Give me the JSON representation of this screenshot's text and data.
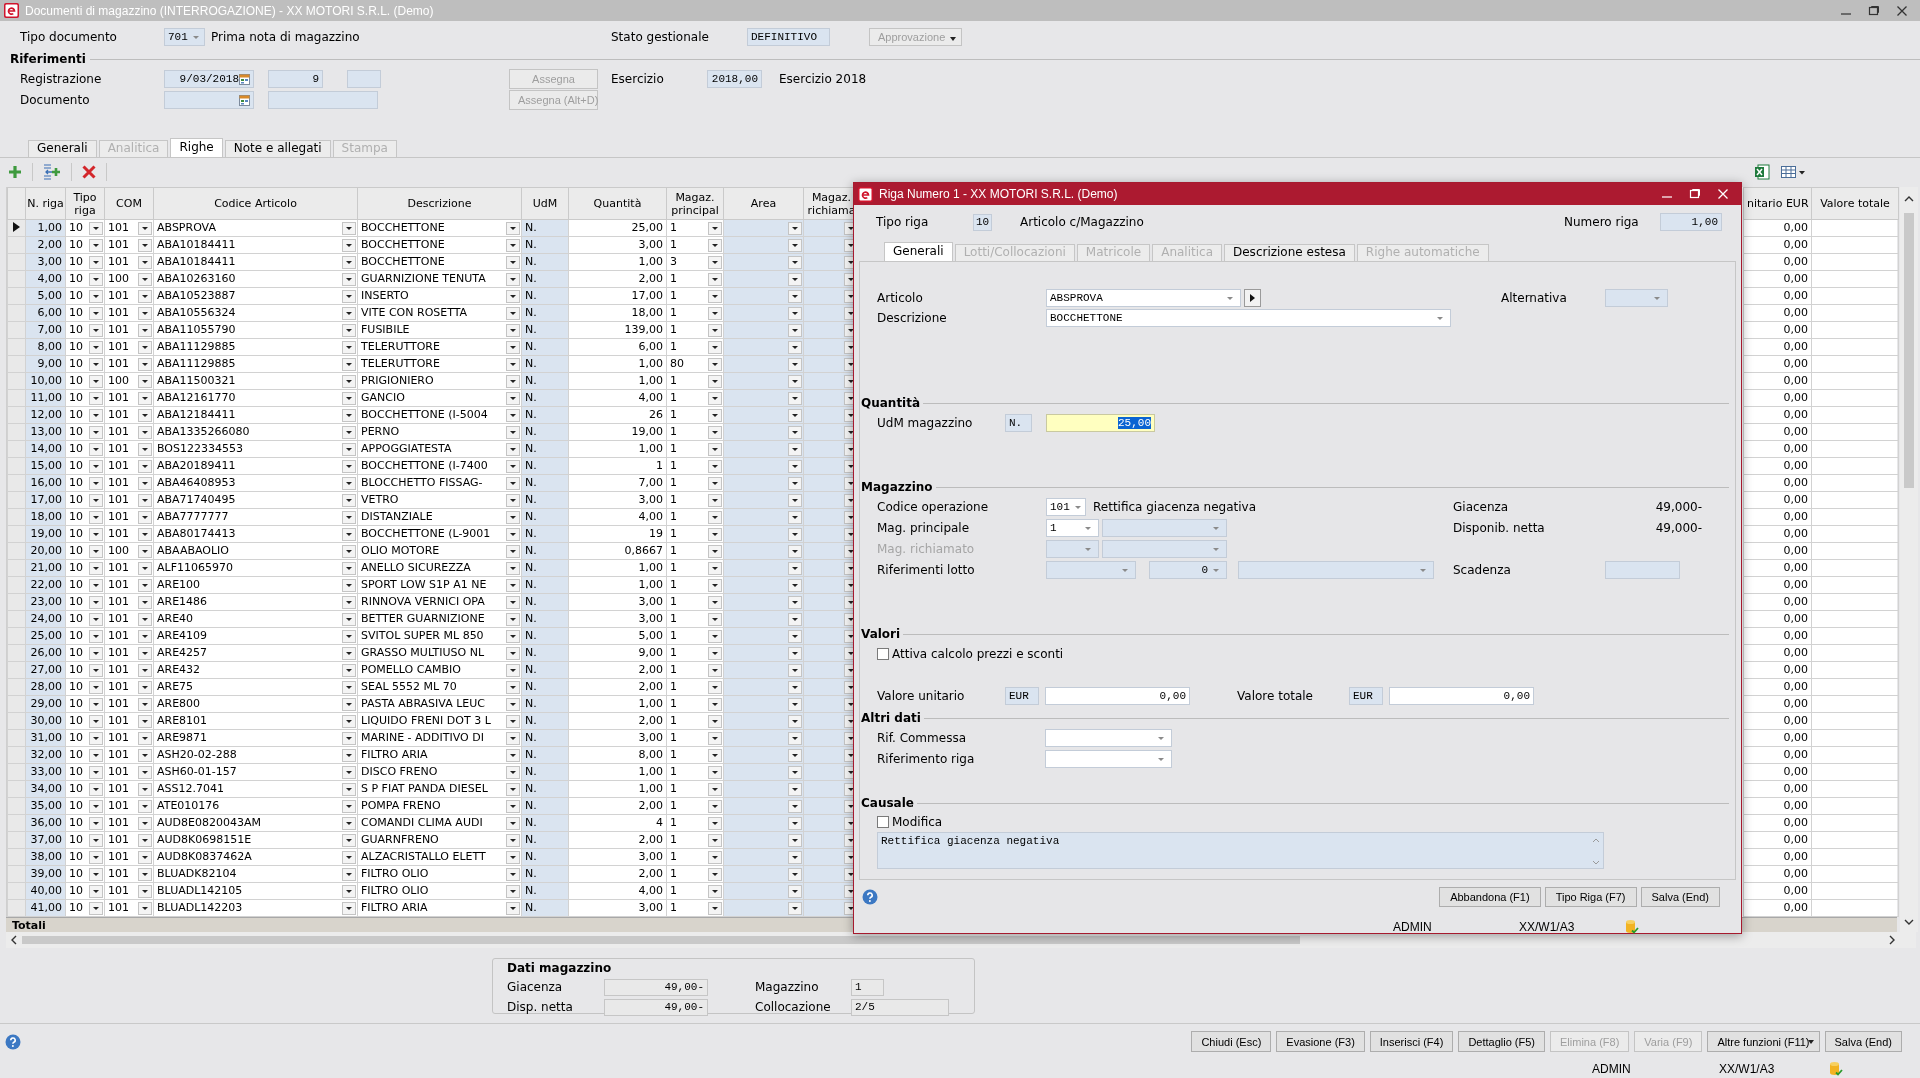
{
  "window": {
    "title": "Documenti di magazzino (INTERROGAZIONE) - XX MOTORI S.R.L. (Demo)"
  },
  "header": {
    "tipo_documento": {
      "label": "Tipo documento",
      "code": "701",
      "name": "Prima nota di magazzino"
    },
    "stato_gestionale": {
      "label": "Stato gestionale",
      "value": "DEFINITIVO"
    },
    "approvazione": {
      "label": "Approvazione",
      "disabled": true,
      "kind": "menu"
    },
    "riferimenti": {
      "title": "Riferimenti",
      "registrazione": {
        "label": "Registrazione",
        "date": "9/03/2018",
        "number": "9"
      },
      "documento": {
        "label": "Documento"
      },
      "assegna": {
        "label": "Assegna",
        "disabled": true
      },
      "assegna_documento": {
        "label": "Assegna (Alt+D)",
        "disabled": true
      },
      "esercizio": {
        "label": "Esercizio",
        "value": "2018,00",
        "description": "Esercizio 2018"
      }
    }
  },
  "tabs": [
    {
      "label": "Generali",
      "selected": false,
      "disabled": false
    },
    {
      "label": "Analitica",
      "selected": false,
      "disabled": true
    },
    {
      "label": "Righe",
      "selected": true,
      "disabled": false
    },
    {
      "label": "Note e allegati",
      "selected": false,
      "disabled": false
    },
    {
      "label": "Stampa",
      "selected": false,
      "disabled": true
    }
  ],
  "table": {
    "columns": [
      "N. riga",
      "Tipo riga",
      "COM",
      "Codice Articolo",
      "Descrizione",
      "UdM",
      "Quantità",
      "Magaz. principal",
      "Area",
      "Magaz. richiama",
      "nitario EUR",
      "Valore totale"
    ],
    "rows": [
      {
        "selected": true,
        "n_riga": "1,00",
        "tipo_riga": "10",
        "com": "101",
        "codice_articolo": "ABSPROVA",
        "descrizione": "BOCCHETTONE",
        "udm": "N.",
        "quantita": "25,00",
        "magaz_principale": "1",
        "valore_unitario": "0,00"
      },
      {
        "selected": false,
        "n_riga": "2,00",
        "tipo_riga": "10",
        "com": "101",
        "codice_articolo": "ABA10184411",
        "descrizione": "BOCCHETTONE",
        "udm": "N.",
        "quantita": "3,00",
        "magaz_principale": "1",
        "valore_unitario": "0,00"
      },
      {
        "selected": false,
        "n_riga": "3,00",
        "tipo_riga": "10",
        "com": "101",
        "codice_articolo": "ABA10184411",
        "descrizione": "BOCCHETTONE",
        "udm": "N.",
        "quantita": "1,00",
        "magaz_principale": "3",
        "valore_unitario": "0,00"
      },
      {
        "selected": false,
        "n_riga": "4,00",
        "tipo_riga": "10",
        "com": "100",
        "codice_articolo": "ABA10263160",
        "descrizione": "GUARNIZIONE TENUTA",
        "udm": "N.",
        "quantita": "2,00",
        "magaz_principale": "1",
        "valore_unitario": "0,00"
      },
      {
        "selected": false,
        "n_riga": "5,00",
        "tipo_riga": "10",
        "com": "101",
        "codice_articolo": "ABA10523887",
        "descrizione": "INSERTO",
        "udm": "N.",
        "quantita": "17,00",
        "magaz_principale": "1",
        "valore_unitario": "0,00"
      },
      {
        "selected": false,
        "n_riga": "6,00",
        "tipo_riga": "10",
        "com": "101",
        "codice_articolo": "ABA10556324",
        "descrizione": "VITE CON ROSETTA",
        "udm": "N.",
        "quantita": "18,00",
        "magaz_principale": "1",
        "valore_unitario": "0,00"
      },
      {
        "selected": false,
        "n_riga": "7,00",
        "tipo_riga": "10",
        "com": "101",
        "codice_articolo": "ABA11055790",
        "descrizione": "FUSIBILE",
        "udm": "N.",
        "quantita": "139,00",
        "magaz_principale": "1",
        "valore_unitario": "0,00"
      },
      {
        "selected": false,
        "n_riga": "8,00",
        "tipo_riga": "10",
        "com": "101",
        "codice_articolo": "ABA11129885",
        "descrizione": "TELERUTTORE",
        "udm": "N.",
        "quantita": "6,00",
        "magaz_principale": "1",
        "valore_unitario": "0,00"
      },
      {
        "selected": false,
        "n_riga": "9,00",
        "tipo_riga": "10",
        "com": "101",
        "codice_articolo": "ABA11129885",
        "descrizione": "TELERUTTORE",
        "udm": "N.",
        "quantita": "1,00",
        "magaz_principale": "80",
        "valore_unitario": "0,00"
      },
      {
        "selected": false,
        "n_riga": "10,00",
        "tipo_riga": "10",
        "com": "100",
        "codice_articolo": "ABA11500321",
        "descrizione": "PRIGIONIERO",
        "udm": "N.",
        "quantita": "1,00",
        "magaz_principale": "1",
        "valore_unitario": "0,00"
      },
      {
        "selected": false,
        "n_riga": "11,00",
        "tipo_riga": "10",
        "com": "101",
        "codice_articolo": "ABA12161770",
        "descrizione": "GANCIO",
        "udm": "N.",
        "quantita": "4,00",
        "magaz_principale": "1",
        "valore_unitario": "0,00"
      },
      {
        "selected": false,
        "n_riga": "12,00",
        "tipo_riga": "10",
        "com": "101",
        "codice_articolo": "ABA12184411",
        "descrizione": "BOCCHETTONE (I-5004",
        "udm": "N.",
        "quantita": "26",
        "magaz_principale": "1",
        "valore_unitario": "0,00"
      },
      {
        "selected": false,
        "n_riga": "13,00",
        "tipo_riga": "10",
        "com": "101",
        "codice_articolo": "ABA1335266080",
        "descrizione": "PERNO",
        "udm": "N.",
        "quantita": "19,00",
        "magaz_principale": "1",
        "valore_unitario": "0,00"
      },
      {
        "selected": false,
        "n_riga": "14,00",
        "tipo_riga": "10",
        "com": "101",
        "codice_articolo": "BOS122334553",
        "descrizione": "APPOGGIATESTA",
        "udm": "N.",
        "quantita": "1,00",
        "magaz_principale": "1",
        "valore_unitario": "0,00"
      },
      {
        "selected": false,
        "n_riga": "15,00",
        "tipo_riga": "10",
        "com": "101",
        "codice_articolo": "ABA20189411",
        "descrizione": "BOCCHETTONE (I-7400",
        "udm": "N.",
        "quantita": "1",
        "magaz_principale": "1",
        "valore_unitario": "0,00"
      },
      {
        "selected": false,
        "n_riga": "16,00",
        "tipo_riga": "10",
        "com": "101",
        "codice_articolo": "ABA46408953",
        "descrizione": "BLOCCHETTO FISSAG-",
        "udm": "N.",
        "quantita": "7,00",
        "magaz_principale": "1",
        "valore_unitario": "0,00"
      },
      {
        "selected": false,
        "n_riga": "17,00",
        "tipo_riga": "10",
        "com": "101",
        "codice_articolo": "ABA71740495",
        "descrizione": "VETRO",
        "udm": "N.",
        "quantita": "3,00",
        "magaz_principale": "1",
        "valore_unitario": "0,00"
      },
      {
        "selected": false,
        "n_riga": "18,00",
        "tipo_riga": "10",
        "com": "101",
        "codice_articolo": "ABA7777777",
        "descrizione": "DISTANZIALE",
        "udm": "N.",
        "quantita": "4,00",
        "magaz_principale": "1",
        "valore_unitario": "0,00"
      },
      {
        "selected": false,
        "n_riga": "19,00",
        "tipo_riga": "10",
        "com": "101",
        "codice_articolo": "ABA80174413",
        "descrizione": "BOCCHETTONE (L-9001",
        "udm": "N.",
        "quantita": "19",
        "magaz_principale": "1",
        "valore_unitario": "0,00"
      },
      {
        "selected": false,
        "n_riga": "20,00",
        "tipo_riga": "10",
        "com": "100",
        "codice_articolo": "ABAABAOLIO",
        "descrizione": "OLIO MOTORE",
        "udm": "N.",
        "quantita": "0,8667",
        "magaz_principale": "1",
        "valore_unitario": "0,00"
      },
      {
        "selected": false,
        "n_riga": "21,00",
        "tipo_riga": "10",
        "com": "101",
        "codice_articolo": "ALF11065970",
        "descrizione": "ANELLO SICUREZZA",
        "udm": "N.",
        "quantita": "1,00",
        "magaz_principale": "1",
        "valore_unitario": "0,00"
      },
      {
        "selected": false,
        "n_riga": "22,00",
        "tipo_riga": "10",
        "com": "101",
        "codice_articolo": "ARE100",
        "descrizione": "SPORT LOW S1P A1 NE",
        "udm": "N.",
        "quantita": "1,00",
        "magaz_principale": "1",
        "valore_unitario": "0,00"
      },
      {
        "selected": false,
        "n_riga": "23,00",
        "tipo_riga": "10",
        "com": "101",
        "codice_articolo": "ARE1486",
        "descrizione": "RINNOVA VERNICI OPA",
        "udm": "N.",
        "quantita": "3,00",
        "magaz_principale": "1",
        "valore_unitario": "0,00"
      },
      {
        "selected": false,
        "n_riga": "24,00",
        "tipo_riga": "10",
        "com": "101",
        "codice_articolo": "ARE40",
        "descrizione": "BETTER GUARNIZIONE",
        "udm": "N.",
        "quantita": "3,00",
        "magaz_principale": "1",
        "valore_unitario": "0,00"
      },
      {
        "selected": false,
        "n_riga": "25,00",
        "tipo_riga": "10",
        "com": "101",
        "codice_articolo": "ARE4109",
        "descrizione": "SVITOL SUPER ML 850",
        "udm": "N.",
        "quantita": "5,00",
        "magaz_principale": "1",
        "valore_unitario": "0,00"
      },
      {
        "selected": false,
        "n_riga": "26,00",
        "tipo_riga": "10",
        "com": "101",
        "codice_articolo": "ARE4257",
        "descrizione": "GRASSO MULTIUSO NL",
        "udm": "N.",
        "quantita": "9,00",
        "magaz_principale": "1",
        "valore_unitario": "0,00"
      },
      {
        "selected": false,
        "n_riga": "27,00",
        "tipo_riga": "10",
        "com": "101",
        "codice_articolo": "ARE432",
        "descrizione": "POMELLO CAMBIO",
        "udm": "N.",
        "quantita": "2,00",
        "magaz_principale": "1",
        "valore_unitario": "0,00"
      },
      {
        "selected": false,
        "n_riga": "28,00",
        "tipo_riga": "10",
        "com": "101",
        "codice_articolo": "ARE75",
        "descrizione": "SEAL 5552 ML 70",
        "udm": "N.",
        "quantita": "2,00",
        "magaz_principale": "1",
        "valore_unitario": "0,00"
      },
      {
        "selected": false,
        "n_riga": "29,00",
        "tipo_riga": "10",
        "com": "101",
        "codice_articolo": "ARE800",
        "descrizione": "PASTA ABRASIVA LEUC",
        "udm": "N.",
        "quantita": "1,00",
        "magaz_principale": "1",
        "valore_unitario": "0,00"
      },
      {
        "selected": false,
        "n_riga": "30,00",
        "tipo_riga": "10",
        "com": "101",
        "codice_articolo": "ARE8101",
        "descrizione": "LIQUIDO FRENI DOT 3 L",
        "udm": "N.",
        "quantita": "2,00",
        "magaz_principale": "1",
        "valore_unitario": "0,00"
      },
      {
        "selected": false,
        "n_riga": "31,00",
        "tipo_riga": "10",
        "com": "101",
        "codice_articolo": "ARE9871",
        "descrizione": "MARINE - ADDITIVO DI",
        "udm": "N.",
        "quantita": "3,00",
        "magaz_principale": "1",
        "valore_unitario": "0,00"
      },
      {
        "selected": false,
        "n_riga": "32,00",
        "tipo_riga": "10",
        "com": "101",
        "codice_articolo": "ASH20-02-288",
        "descrizione": "FILTRO ARIA",
        "udm": "N.",
        "quantita": "8,00",
        "magaz_principale": "1",
        "valore_unitario": "0,00"
      },
      {
        "selected": false,
        "n_riga": "33,00",
        "tipo_riga": "10",
        "com": "101",
        "codice_articolo": "ASH60-01-157",
        "descrizione": "DISCO FRENO",
        "udm": "N.",
        "quantita": "1,00",
        "magaz_principale": "1",
        "valore_unitario": "0,00"
      },
      {
        "selected": false,
        "n_riga": "34,00",
        "tipo_riga": "10",
        "com": "101",
        "codice_articolo": "ASS12.7041",
        "descrizione": "S P FIAT PANDA DIESEL",
        "udm": "N.",
        "quantita": "1,00",
        "magaz_principale": "1",
        "valore_unitario": "0,00"
      },
      {
        "selected": false,
        "n_riga": "35,00",
        "tipo_riga": "10",
        "com": "101",
        "codice_articolo": "ATE010176",
        "descrizione": "POMPA FRENO",
        "udm": "N.",
        "quantita": "2,00",
        "magaz_principale": "1",
        "valore_unitario": "0,00"
      },
      {
        "selected": false,
        "n_riga": "36,00",
        "tipo_riga": "10",
        "com": "101",
        "codice_articolo": "AUD8E0820043AM",
        "descrizione": "COMANDI CLIMA AUDI",
        "udm": "N.",
        "quantita": "4",
        "magaz_principale": "1",
        "valore_unitario": "0,00"
      },
      {
        "selected": false,
        "n_riga": "37,00",
        "tipo_riga": "10",
        "com": "101",
        "codice_articolo": "AUD8K0698151E",
        "descrizione": "GUARNFRENO",
        "udm": "N.",
        "quantita": "2,00",
        "magaz_principale": "1",
        "valore_unitario": "0,00"
      },
      {
        "selected": false,
        "n_riga": "38,00",
        "tipo_riga": "10",
        "com": "101",
        "codice_articolo": "AUD8K0837462A",
        "descrizione": "ALZACRISTALLO ELETT",
        "udm": "N.",
        "quantita": "3,00",
        "magaz_principale": "1",
        "valore_unitario": "0,00"
      },
      {
        "selected": false,
        "n_riga": "39,00",
        "tipo_riga": "10",
        "com": "101",
        "codice_articolo": "BLUADK82104",
        "descrizione": "FILTRO OLIO",
        "udm": "N.",
        "quantita": "2,00",
        "magaz_principale": "1",
        "valore_unitario": "0,00"
      },
      {
        "selected": false,
        "n_riga": "40,00",
        "tipo_riga": "10",
        "com": "101",
        "codice_articolo": "BLUADL142105",
        "descrizione": "FILTRO OLIO",
        "udm": "N.",
        "quantita": "4,00",
        "magaz_principale": "1",
        "valore_unitario": "0,00"
      },
      {
        "selected": false,
        "n_riga": "41,00",
        "tipo_riga": "10",
        "com": "101",
        "codice_articolo": "BLUADL142203",
        "descrizione": "FILTRO ARIA",
        "udm": "N.",
        "quantita": "3,00",
        "magaz_principale": "1",
        "valore_unitario": "0,00"
      }
    ],
    "totals_label": "Totali"
  },
  "dialog": {
    "title": "Riga Numero 1 - XX MOTORI S.R.L. (Demo)",
    "tipo_riga": {
      "label": "Tipo riga",
      "code": "10",
      "name": "Articolo c/Magazzino"
    },
    "numero_riga": {
      "label": "Numero riga",
      "value": "1,00"
    },
    "tabs": [
      {
        "label": "Generali",
        "selected": true,
        "disabled": false
      },
      {
        "label": "Lotti/Collocazioni",
        "selected": false,
        "disabled": true
      },
      {
        "label": "Matricole",
        "selected": false,
        "disabled": true
      },
      {
        "label": "Analitica",
        "selected": false,
        "disabled": true
      },
      {
        "label": "Descrizione estesa",
        "selected": false,
        "disabled": false
      },
      {
        "label": "Righe automatiche",
        "selected": false,
        "disabled": true
      }
    ],
    "articolo": {
      "label": "Articolo",
      "value": "ABSPROVA"
    },
    "descrizione": {
      "label": "Descrizione",
      "value": "BOCCHETTONE"
    },
    "alternativa": {
      "label": "Alternativa"
    },
    "quantita": {
      "title": "Quantità",
      "label": "UdM magazzino",
      "unit": "N.",
      "value": "25,00",
      "focused": true
    },
    "magazzino": {
      "title": "Magazzino",
      "codice_operazione": {
        "label": "Codice operazione",
        "code": "101",
        "description": "Rettifica giacenza negativa"
      },
      "mag_principale": {
        "label": "Mag. principale",
        "value": "1",
        "disabled": false
      },
      "mag_richiamato": {
        "label": "Mag. richiamato",
        "disabled": true
      },
      "riferimenti_lotto": {
        "label": "Riferimenti lotto",
        "value": "0"
      },
      "giacenza": {
        "label": "Giacenza",
        "value": "49,000-"
      },
      "disponibilita": {
        "label": "Disponib. netta",
        "value": "49,000-"
      },
      "scadenza": {
        "label": "Scadenza"
      }
    },
    "valori": {
      "title": "Valori",
      "calcolo": {
        "label": "Attiva calcolo prezzi e sconti",
        "checked": false
      },
      "valore_unitario": {
        "label": "Valore unitario",
        "currency": "EUR",
        "value": "0,00"
      },
      "valore_totale": {
        "label": "Valore totale",
        "currency": "EUR",
        "value": "0,00"
      }
    },
    "altri_dati": {
      "title": "Altri dati",
      "rif_commessa": {
        "label": "Rif. Commessa"
      },
      "riferimento_riga": {
        "label": "Riferimento riga"
      }
    },
    "causale": {
      "title": "Causale",
      "modifica": {
        "label": "Modifica",
        "checked": false
      },
      "text": "Rettifica giacenza negativa"
    },
    "buttons": [
      {
        "label": "Abbandona (F1)",
        "disabled": false
      },
      {
        "label": "Tipo Riga (F7)",
        "disabled": false
      },
      {
        "label": "Salva (End)",
        "disabled": false
      }
    ],
    "status_bar": {
      "user": "ADMIN",
      "path": "XX/W1/A3"
    }
  },
  "stock_panel": {
    "title": "Dati magazzino",
    "giacenza": {
      "label": "Giacenza",
      "value": "49,00-"
    },
    "disp_netta": {
      "label": "Disp. netta",
      "value": "49,00-"
    },
    "magazzino": {
      "label": "Magazzino",
      "value": "1"
    },
    "collocazione": {
      "label": "Collocazione",
      "value": "2/5"
    }
  },
  "buttons": [
    {
      "label": "Chiudi (Esc)",
      "disabled": false,
      "kind": "button"
    },
    {
      "label": "Evasione (F3)",
      "disabled": false,
      "kind": "button"
    },
    {
      "label": "Inserisci (F4)",
      "disabled": false,
      "kind": "button"
    },
    {
      "label": "Dettaglio (F5)",
      "disabled": false,
      "kind": "button"
    },
    {
      "label": "Elimina (F8)",
      "disabled": true,
      "kind": "button"
    },
    {
      "label": "Varia (F9)",
      "disabled": true,
      "kind": "button"
    },
    {
      "label": "Altre funzioni (F11)",
      "disabled": false,
      "kind": "menu"
    },
    {
      "label": "Salva (End)",
      "disabled": false,
      "kind": "button"
    }
  ],
  "status_bar": {
    "user": "ADMIN",
    "path": "XX/W1/A3"
  }
}
